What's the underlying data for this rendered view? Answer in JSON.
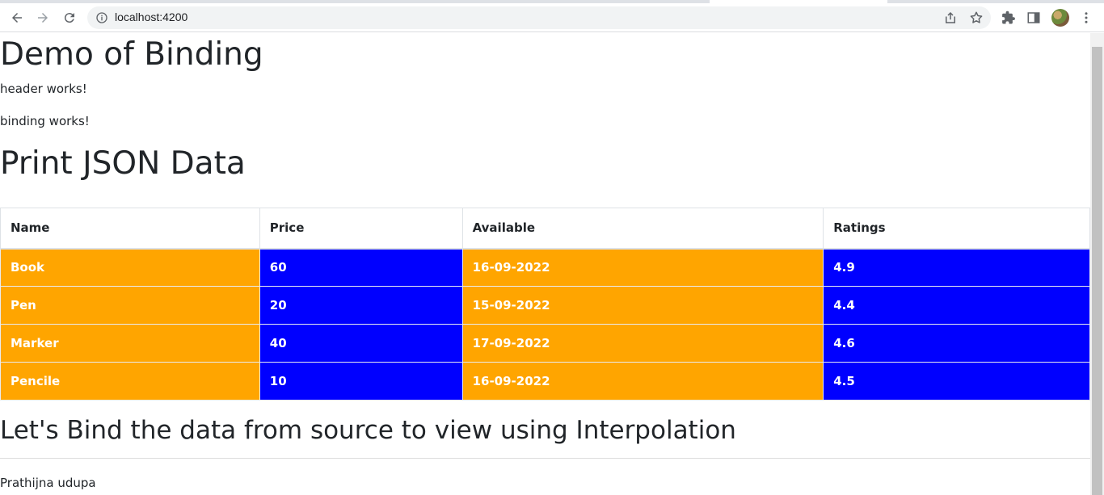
{
  "browser": {
    "url": "localhost:4200"
  },
  "page": {
    "title": "Demo of Binding",
    "header_text": "header works!",
    "binding_text": "binding works!",
    "subtitle": "Print JSON Data",
    "table": {
      "headers": [
        "Name",
        "Price",
        "Available",
        "Ratings"
      ],
      "rows": [
        {
          "name": "Book",
          "price": "60",
          "available": "16-09-2022",
          "ratings": "4.9"
        },
        {
          "name": "Pen",
          "price": "20",
          "available": "15-09-2022",
          "ratings": "4.4"
        },
        {
          "name": "Marker",
          "price": "40",
          "available": "17-09-2022",
          "ratings": "4.6"
        },
        {
          "name": "Pencile",
          "price": "10",
          "available": "16-09-2022",
          "ratings": "4.5"
        }
      ]
    },
    "interpolation_heading": "Let's Bind the data from source to view using Interpolation",
    "author": "Prathijna udupa"
  },
  "colors": {
    "orange_cell": "#ffa500",
    "blue_cell": "#0000ff"
  },
  "icons": [
    "back-icon",
    "forward-icon",
    "reload-icon",
    "info-icon",
    "share-icon",
    "star-icon",
    "extensions-icon",
    "side-panel-icon",
    "profile-avatar",
    "menu-icon"
  ]
}
